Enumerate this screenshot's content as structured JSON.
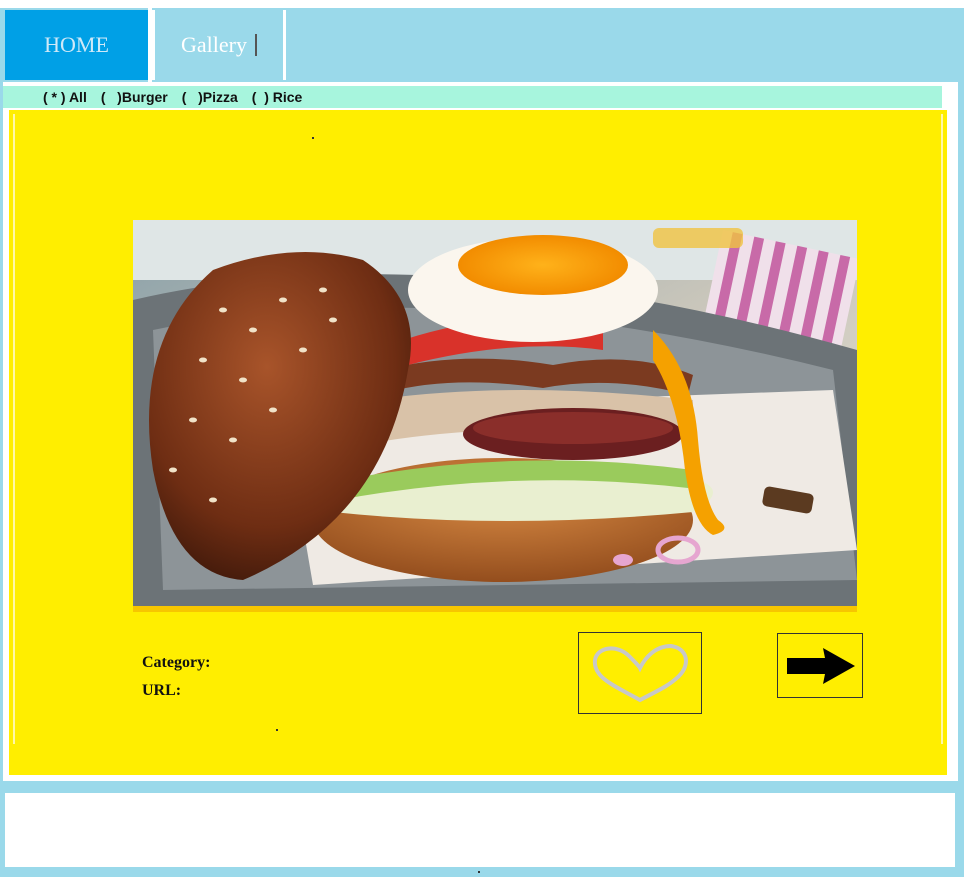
{
  "nav": {
    "tabs": [
      {
        "label": "HOME"
      },
      {
        "label": "Gallery"
      }
    ]
  },
  "filter": {
    "options": [
      {
        "marker": "( * )",
        "label": "All"
      },
      {
        "marker": "(   )",
        "label": "Burger"
      },
      {
        "marker": "(   )",
        "label": "Pizza"
      },
      {
        "marker": "(  )",
        "label": "Rice"
      }
    ],
    "selected": "All"
  },
  "card": {
    "category_label": "Category:",
    "url_label": "URL:",
    "image_subject": "burger-photo"
  },
  "icons": {
    "favorite": "heart-outline-icon",
    "next": "right-arrow-icon"
  },
  "colors": {
    "nav_bg": "#9ad9ea",
    "home_tab": "#00a0e6",
    "filter_bar": "#a7f5dd",
    "panel": "#ffee00"
  }
}
